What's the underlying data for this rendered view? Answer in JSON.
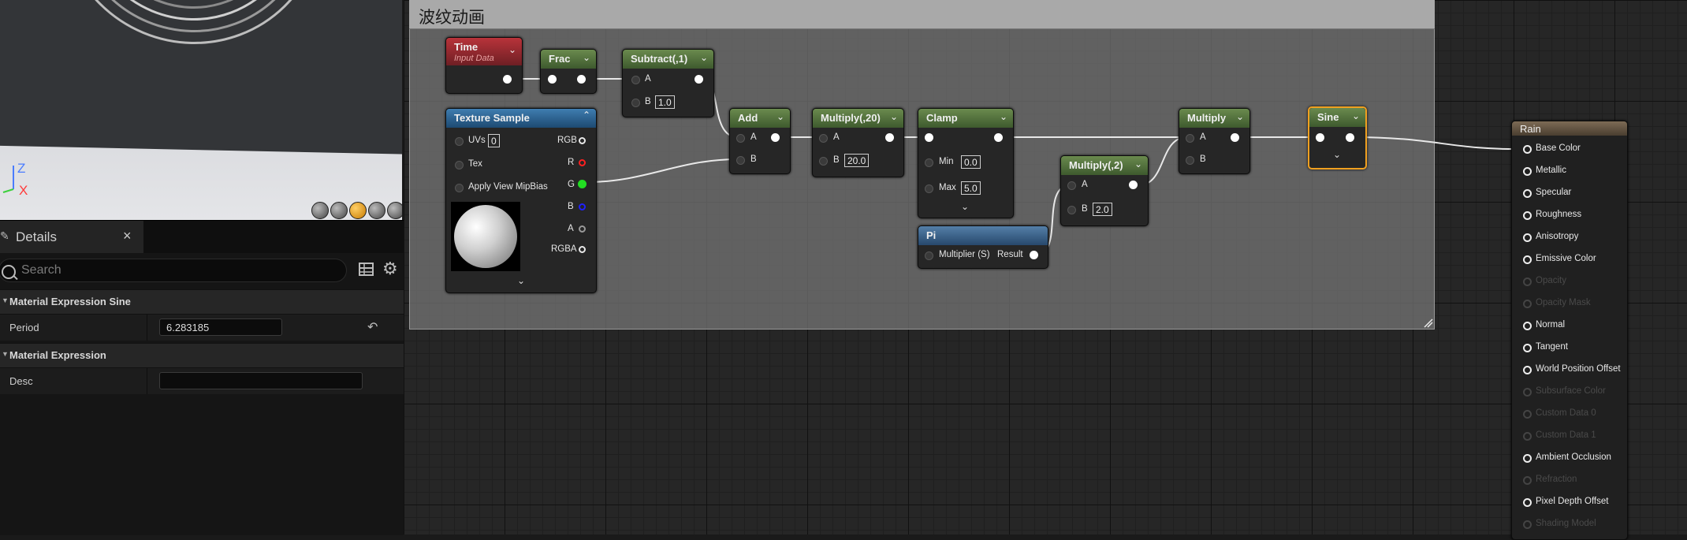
{
  "viewport": {
    "axis_z": "Z",
    "axis_x": "X",
    "preview_buttons": [
      "cylinder-icon",
      "sphere-icon",
      "plane-icon",
      "cube-icon",
      "teapot-icon"
    ]
  },
  "details": {
    "tab_title": "Details",
    "close_glyph": "×",
    "search_placeholder": "Search",
    "categories": [
      {
        "label": "Material Expression Sine",
        "props": [
          {
            "label": "Period",
            "value": "6.283185"
          }
        ]
      },
      {
        "label": "Material Expression",
        "props": [
          {
            "label": "Desc",
            "value": ""
          }
        ]
      }
    ]
  },
  "graph": {
    "comment_title": "波纹动画",
    "nodes": {
      "time": {
        "title": "Time",
        "subtitle": "Input Data"
      },
      "frac": {
        "title": "Frac"
      },
      "subtract": {
        "title": "Subtract(,1)",
        "pin_a": "A",
        "pin_b": "B",
        "b_value": "1.0"
      },
      "texture_sample": {
        "title": "Texture Sample",
        "inputs": [
          "UVs",
          "Tex",
          "Apply View MipBias"
        ],
        "uvs_value": "0",
        "outputs": [
          "RGB",
          "R",
          "G",
          "B",
          "A",
          "RGBA"
        ]
      },
      "add": {
        "title": "Add",
        "pin_a": "A",
        "pin_b": "B"
      },
      "multiply20": {
        "title": "Multiply(,20)",
        "pin_a": "A",
        "pin_b": "B",
        "b_value": "20.0"
      },
      "clamp": {
        "title": "Clamp",
        "min_label": "Min",
        "min_value": "0.0",
        "max_label": "Max",
        "max_value": "5.0"
      },
      "pi": {
        "title": "Pi",
        "input": "Multiplier (S)",
        "output": "Result"
      },
      "multiply2": {
        "title": "Multiply(,2)",
        "pin_a": "A",
        "pin_b": "B",
        "b_value": "2.0"
      },
      "multiply": {
        "title": "Multiply",
        "pin_a": "A",
        "pin_b": "B"
      },
      "sine": {
        "title": "Sine"
      },
      "result": {
        "title": "Rain",
        "pins": [
          {
            "label": "Base Color",
            "enabled": true
          },
          {
            "label": "Metallic",
            "enabled": true
          },
          {
            "label": "Specular",
            "enabled": true
          },
          {
            "label": "Roughness",
            "enabled": true
          },
          {
            "label": "Anisotropy",
            "enabled": true
          },
          {
            "label": "Emissive Color",
            "enabled": true
          },
          {
            "label": "Opacity",
            "enabled": false
          },
          {
            "label": "Opacity Mask",
            "enabled": false
          },
          {
            "label": "Normal",
            "enabled": true
          },
          {
            "label": "Tangent",
            "enabled": true
          },
          {
            "label": "World Position Offset",
            "enabled": true
          },
          {
            "label": "Subsurface Color",
            "enabled": false
          },
          {
            "label": "Custom Data 0",
            "enabled": false
          },
          {
            "label": "Custom Data 1",
            "enabled": false
          },
          {
            "label": "Ambient Occlusion",
            "enabled": true
          },
          {
            "label": "Refraction",
            "enabled": false
          },
          {
            "label": "Pixel Depth Offset",
            "enabled": true
          },
          {
            "label": "Shading Model",
            "enabled": false
          }
        ]
      }
    }
  }
}
